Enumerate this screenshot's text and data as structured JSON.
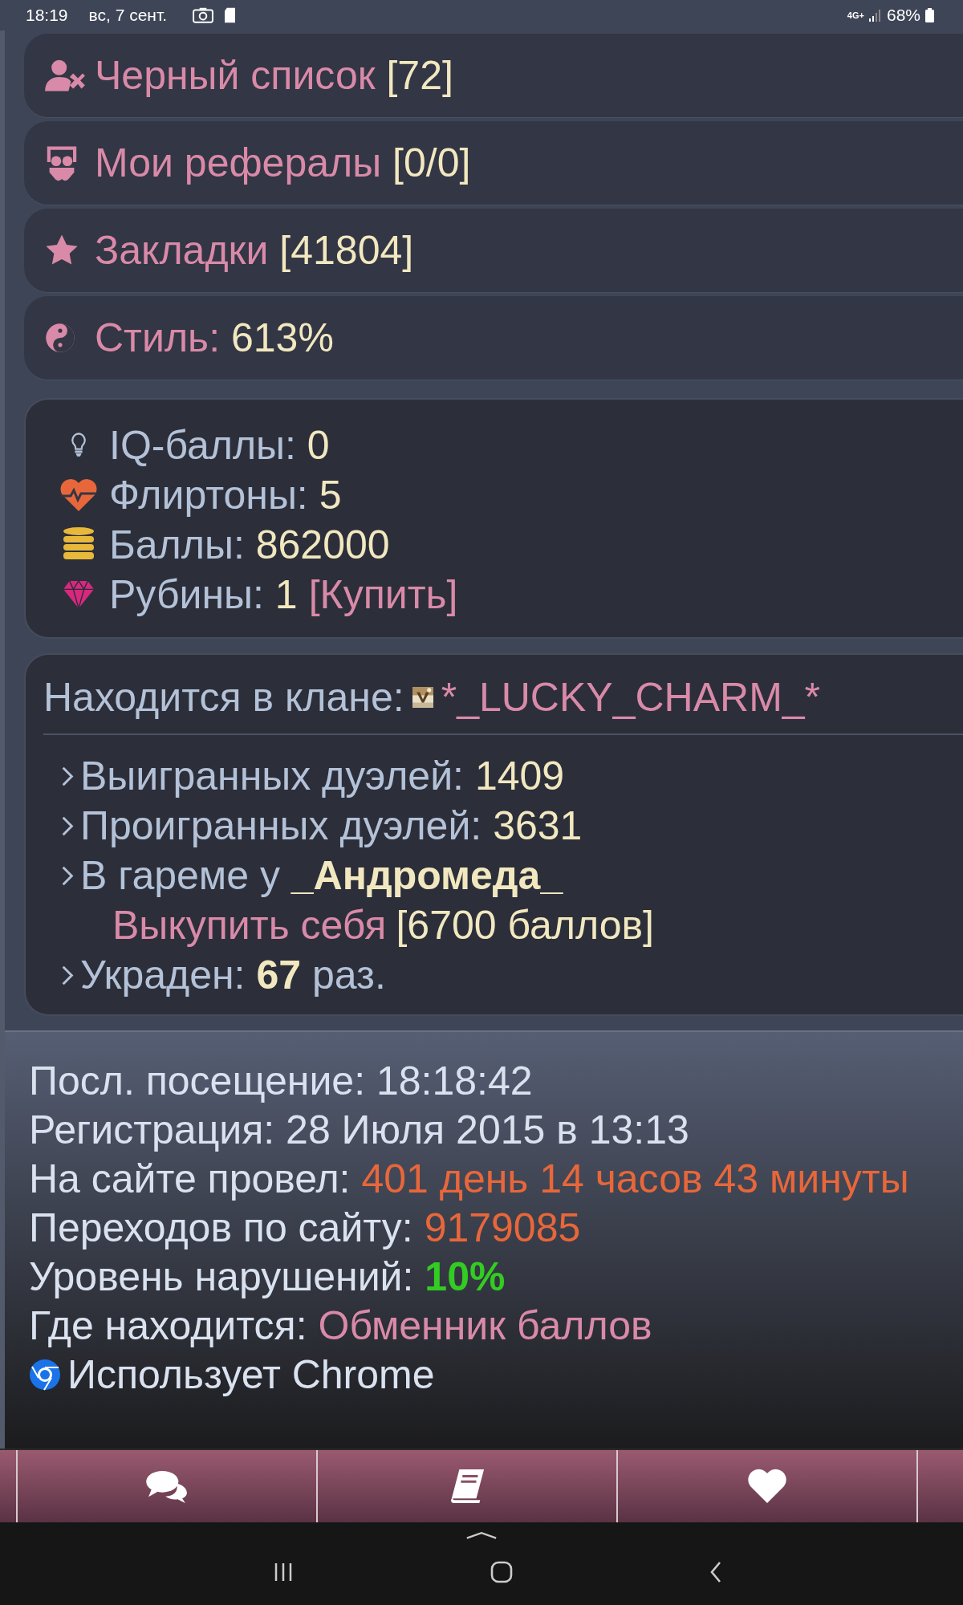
{
  "status_bar": {
    "time": "18:19",
    "date": "вс, 7 сент.",
    "network": "4G+",
    "battery": "68%"
  },
  "menu_items": [
    {
      "kind": "blocked",
      "label": "Черный список",
      "value": "[72]"
    },
    {
      "kind": "referrals",
      "label": "Мои рефералы",
      "value": "[0/0]"
    },
    {
      "kind": "bookmarks",
      "label": "Закладки",
      "value": "[41804]"
    },
    {
      "kind": "style",
      "label": "Стиль:",
      "value": "613%"
    }
  ],
  "resources": [
    {
      "kind": "iq",
      "label": "IQ-баллы:",
      "value": "0"
    },
    {
      "kind": "flirt",
      "label": "Флиртоны:",
      "value": "5"
    },
    {
      "kind": "points",
      "label": "Баллы:",
      "value": "862000"
    },
    {
      "kind": "rubies",
      "label": "Рубины:",
      "value": "1",
      "link": "[Купить]"
    }
  ],
  "clan": {
    "label": "Находится в клане:",
    "name": "*_LUCKY_CHARM_*"
  },
  "duels": [
    {
      "kind": "plain",
      "label": "Выигранных дуэлей:",
      "value": "1409"
    },
    {
      "kind": "plain",
      "label": "Проигранных дуэлей:",
      "value": "3631"
    },
    {
      "kind": "harem",
      "label": "В гареме у",
      "value": "_Андромеда_",
      "link": "Выкупить себя",
      "price": "[6700 баллов]"
    },
    {
      "kind": "stolen",
      "label": "Украден:",
      "value": "67",
      "suffix": "раз."
    }
  ],
  "stats": [
    {
      "kind": "plain",
      "label": "Посл. посещение:",
      "value": "18:18:42"
    },
    {
      "kind": "plain",
      "label": "Регистрация:",
      "value": "28 Июля 2015 в 13:13"
    },
    {
      "kind": "orange",
      "label": "На сайте провел:",
      "value": "401 день 14 часов 43 минуты"
    },
    {
      "kind": "orange",
      "label": "Переходов по сайту:",
      "value": "9179085"
    },
    {
      "kind": "green",
      "label": "Уровень нарушений:",
      "value": "10%"
    },
    {
      "kind": "pink",
      "label": "Где находится:",
      "value": "Обменник баллов"
    },
    {
      "kind": "browser",
      "label": "Использует Chrome"
    }
  ],
  "bottom_nav": [
    {
      "kind": "chat"
    },
    {
      "kind": "book"
    },
    {
      "kind": "heart"
    }
  ]
}
